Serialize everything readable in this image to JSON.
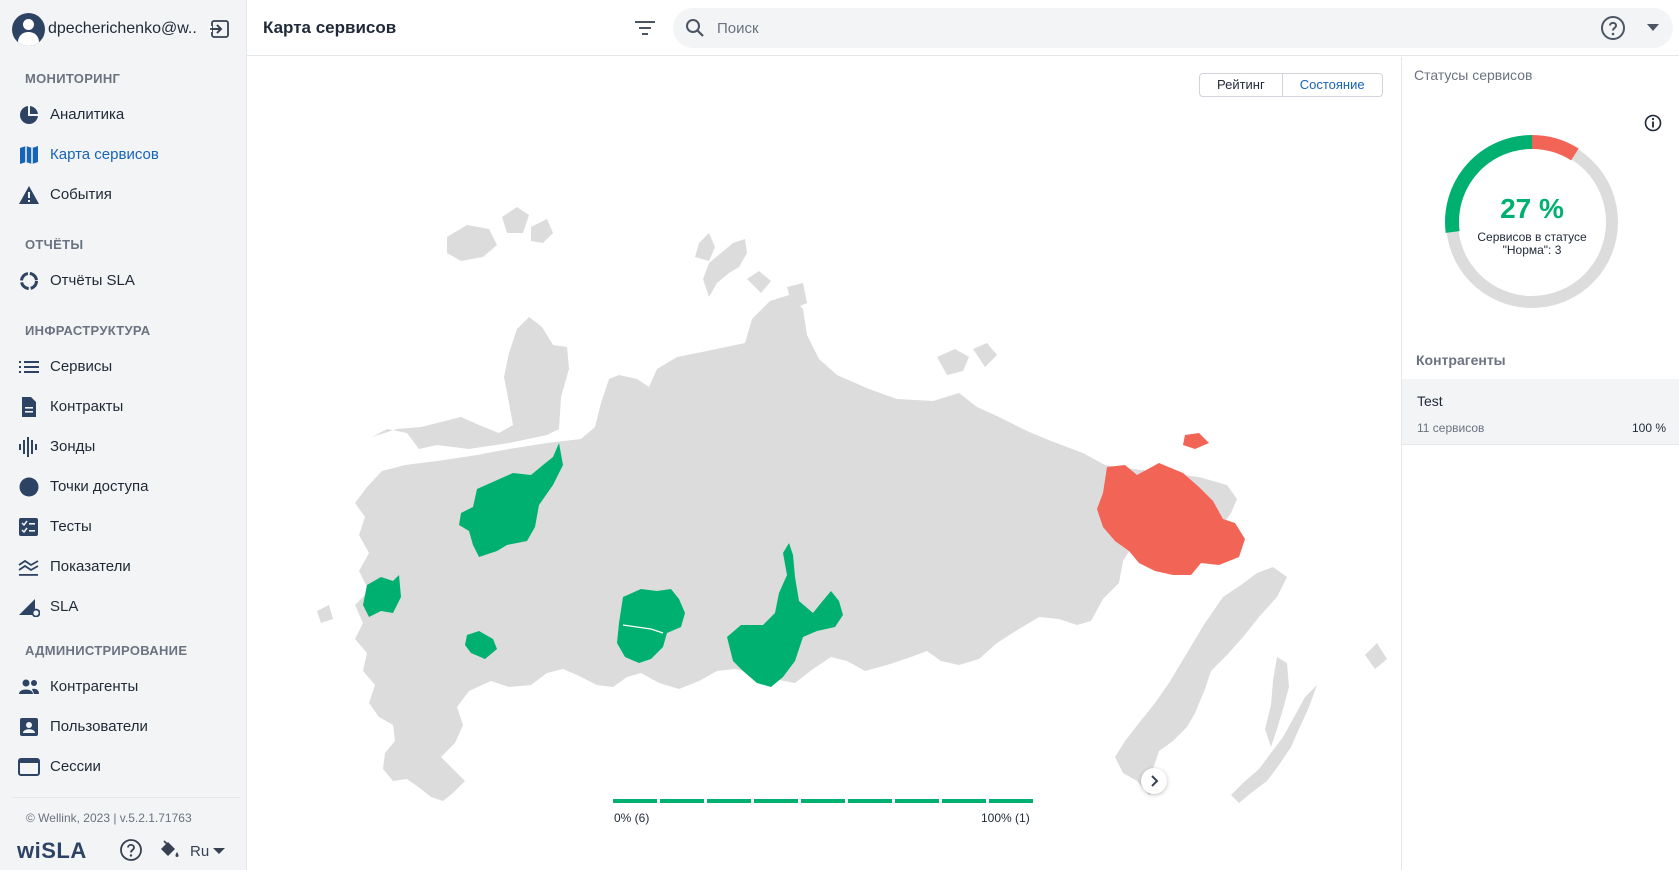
{
  "user": {
    "name": "dpecherichenko@w..."
  },
  "sidebar": {
    "sections": [
      {
        "title": "МОНИТОРИНГ",
        "items": [
          {
            "label": "Аналитика",
            "icon": "pie-chart-icon"
          },
          {
            "label": "Карта сервисов",
            "icon": "map-icon",
            "active": true
          },
          {
            "label": "События",
            "icon": "warning-icon"
          }
        ]
      },
      {
        "title": "ОТЧЁТЫ",
        "items": [
          {
            "label": "Отчёты SLA",
            "icon": "donut-report-icon"
          }
        ]
      },
      {
        "title": "ИНФРАСТРУКТУРА",
        "items": [
          {
            "label": "Сервисы",
            "icon": "list-icon"
          },
          {
            "label": "Контракты",
            "icon": "document-icon"
          },
          {
            "label": "Зонды",
            "icon": "probe-wave-icon"
          },
          {
            "label": "Точки доступа",
            "icon": "access-point-icon"
          },
          {
            "label": "Тесты",
            "icon": "checklist-icon"
          },
          {
            "label": "Показатели",
            "icon": "metrics-icon"
          },
          {
            "label": "SLA",
            "icon": "sla-gear-icon"
          }
        ]
      },
      {
        "title": "АДМИНИСТРИРОВАНИЕ",
        "items": [
          {
            "label": "Контрагенты",
            "icon": "people-icon"
          },
          {
            "label": "Пользователи",
            "icon": "user-card-icon"
          },
          {
            "label": "Сессии",
            "icon": "window-icon"
          }
        ]
      }
    ],
    "copyright": "© Wellink, 2023 | v.5.2.1.71763",
    "brand": "wiSLA",
    "language": "Ru"
  },
  "header": {
    "title": "Карта сервисов",
    "search_placeholder": "Поиск"
  },
  "map": {
    "toggle": {
      "first": "Рейтинг",
      "second": "Состояние"
    },
    "legend": {
      "min": "0% (6)",
      "max": "100% (1)"
    },
    "colors": {
      "land": "#dcdcdc",
      "ok": "#00b071",
      "bad": "#f26456"
    }
  },
  "statuses": {
    "title": "Статусы сервисов",
    "percent_label": "27 %",
    "percent_value": 27,
    "alarm_fraction": 0.09,
    "caption": "Сервисов в статусе \"Норма\": 3"
  },
  "contractors": {
    "title": "Контрагенты",
    "items": [
      {
        "name": "Test",
        "services": "11 сервисов",
        "percent": "100 %"
      }
    ]
  }
}
